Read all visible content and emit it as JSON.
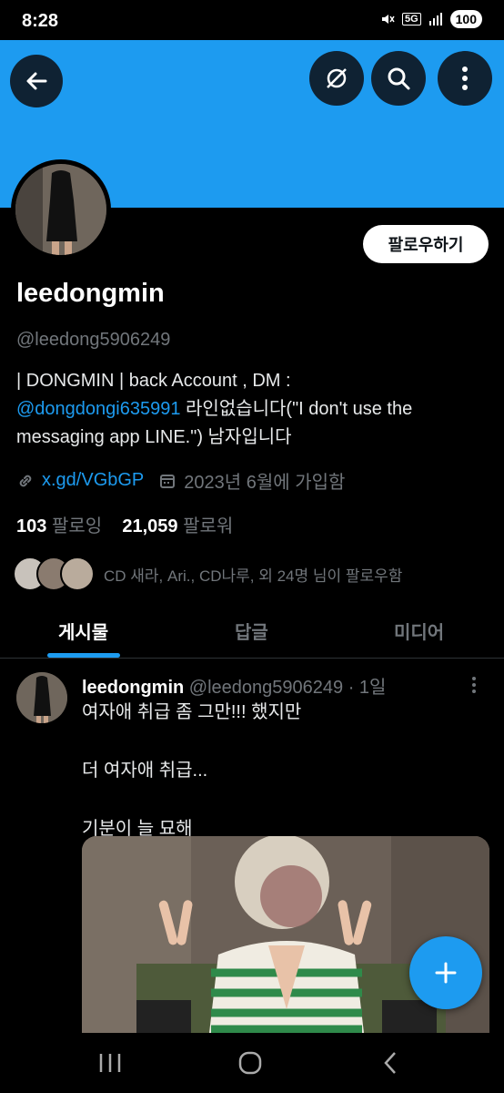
{
  "status": {
    "time": "8:28",
    "network": "5G",
    "battery": "100"
  },
  "header": {
    "back_icon": "arrow-left-icon",
    "grok_icon": "grok-icon",
    "search_icon": "search-icon",
    "more_icon": "more-vertical-icon"
  },
  "colors": {
    "accent": "#1d9bf0",
    "banner": "#1d9bf0",
    "background": "#000000",
    "muted": "#71767b"
  },
  "profile": {
    "follow_label": "팔로우하기",
    "display_name": "leedongmin",
    "handle": "@leedong5906249",
    "bio_line1": "| DONGMIN | back Account , DM :",
    "bio_mention": "@dongdongi635991",
    "bio_line2_rest": " 라인없습니다(\"I don't use the",
    "bio_line3": "messaging app LINE.\") 남자입니다",
    "link": "x.gd/VGbGP",
    "joined": "2023년 6월에 가입함",
    "following_count": "103",
    "following_label": "팔로잉",
    "followers_count": "21,059",
    "followers_label": "팔로워",
    "known_followers": "CD 새라, Ari., CD나루, 외 24명 님이 팔로우함"
  },
  "tabs": [
    {
      "label": "게시물",
      "active": true
    },
    {
      "label": "답글",
      "active": false
    },
    {
      "label": "미디어",
      "active": false
    }
  ],
  "tweet": {
    "author": "leedongmin",
    "handle": "@leedong5906249",
    "time": "· 1일",
    "line1": "여자애 취급 좀 그만!!! 했지만",
    "line2": "더 여자애 취급...",
    "line3": "기분이 늘 묘해"
  },
  "fab": {
    "icon": "plus-icon"
  },
  "nav": {
    "recent_icon": "recent-apps-icon",
    "home_icon": "home-icon",
    "back_icon": "back-chevron-icon"
  }
}
